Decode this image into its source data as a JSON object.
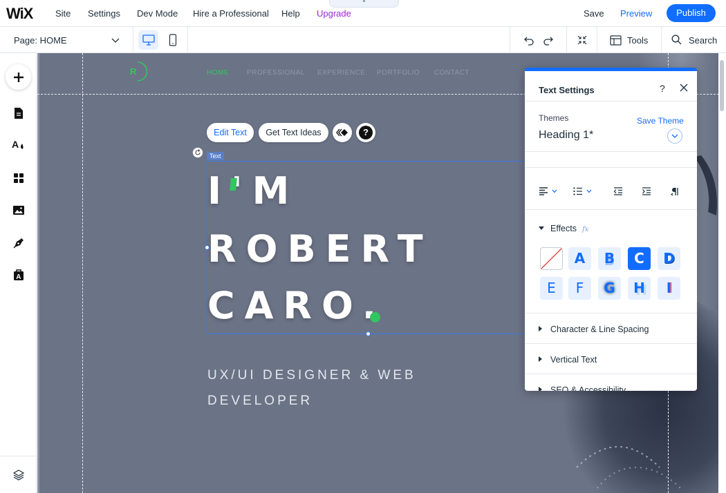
{
  "topbar": {
    "logo": "WiX",
    "menu": [
      "Site",
      "Settings",
      "Dev Mode",
      "Hire a Professional",
      "Help",
      "Upgrade"
    ],
    "collapse_glyph": "⌃",
    "save": "Save",
    "preview": "Preview",
    "publish": "Publish"
  },
  "subbar": {
    "page_label": "Page: HOME",
    "tools": "Tools",
    "search": "Search"
  },
  "site": {
    "logo_letter": "R",
    "nav": [
      "HOME",
      "PROFESSIONAL",
      "EXPERIENCE",
      "PORTFOLIO",
      "CONTACT"
    ],
    "headline": [
      "I'M",
      "ROBERT",
      "CARO."
    ],
    "subhead": [
      "UX/UI DESIGNER & WEB",
      "DEVELOPER"
    ]
  },
  "floating_toolbar": {
    "edit_text": "Edit Text",
    "get_text_ideas": "Get Text Ideas",
    "help": "?"
  },
  "selection": {
    "tag": "Text"
  },
  "text_settings": {
    "title": "Text Settings",
    "help": "?",
    "themes_label": "Themes",
    "save_theme": "Save Theme",
    "theme_value": "Heading 1*",
    "effects_label": "Effects",
    "effects_fx": "fx",
    "effects": [
      "A",
      "B",
      "C",
      "D",
      "E",
      "F",
      "G",
      "H",
      "I"
    ],
    "selected_effect": "C",
    "sections": [
      "Character & Line Spacing",
      "Vertical Text",
      "SEO & Accessibility"
    ]
  },
  "colors": {
    "accent": "#116dff",
    "upgrade": "#9a27d5",
    "brand_green": "#33c55e",
    "canvas_bg": "#6b7386"
  }
}
